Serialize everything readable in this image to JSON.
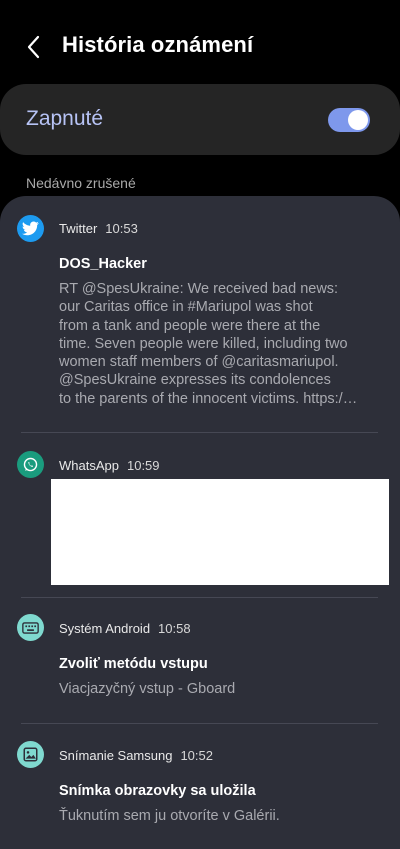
{
  "header": {
    "title": "História oznámení"
  },
  "toggle": {
    "label": "Zapnuté"
  },
  "section": {
    "label": "Nedávno zrušené"
  },
  "notifications": [
    {
      "app": "Twitter",
      "time": "10:53",
      "title": "DOS_Hacker",
      "body_lines": [
        "RT @SpesUkraine: We received bad news:",
        "our Caritas office in #Mariupol was shot",
        "from a tank and people were there at the",
        "time. Seven people were killed, including two",
        "women staff members of @caritasmariupol.",
        "@SpesUkraine expresses its condolences",
        "to the parents of the innocent victims. https:/…"
      ],
      "icon": "twitter-bird-icon",
      "color": "#1d9bf0"
    },
    {
      "app": "WhatsApp",
      "time": "10:59",
      "icon": "whatsapp-icon",
      "color": "#1a9c7e"
    },
    {
      "app": "Systém Android",
      "time": "10:58",
      "title": "Zvoliť metódu vstupu",
      "body": "Viacjazyčný vstup - Gboard",
      "icon": "keyboard-icon",
      "color": "#7fd9cf"
    },
    {
      "app": "Snímanie Samsung",
      "time": "10:52",
      "title": "Snímka obrazovky sa uložila",
      "body": "Ťuknutím sem ju otvoríte v Galérii.",
      "icon": "image-icon",
      "color": "#7fd9cf"
    }
  ]
}
